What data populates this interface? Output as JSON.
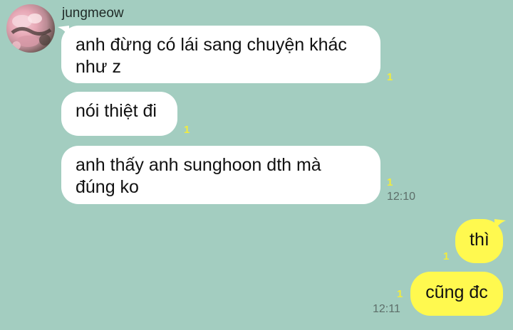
{
  "chat": {
    "sender_name": "jungmeow",
    "messages": [
      {
        "from": "them",
        "lines": [
          "anh đừng có lái sang chuyện khác",
          "như z"
        ],
        "read_count": "1",
        "time": ""
      },
      {
        "from": "them",
        "lines": [
          "nói thiệt đi"
        ],
        "read_count": "1",
        "time": ""
      },
      {
        "from": "them",
        "lines": [
          "anh thấy anh sunghoon dth mà",
          "đúng ko"
        ],
        "read_count": "1",
        "time": "12:10"
      },
      {
        "from": "me",
        "lines": [
          "thì"
        ],
        "read_count": "1",
        "time": ""
      },
      {
        "from": "me",
        "lines": [
          "cũng đc"
        ],
        "read_count": "1",
        "time": "12:11"
      }
    ]
  },
  "colors": {
    "background": "#a3cdc0",
    "incoming_bubble": "#ffffff",
    "outgoing_bubble": "#fff94f",
    "read_count": "#f2ec3c"
  },
  "icons": {
    "avatar": "profile-photo"
  }
}
